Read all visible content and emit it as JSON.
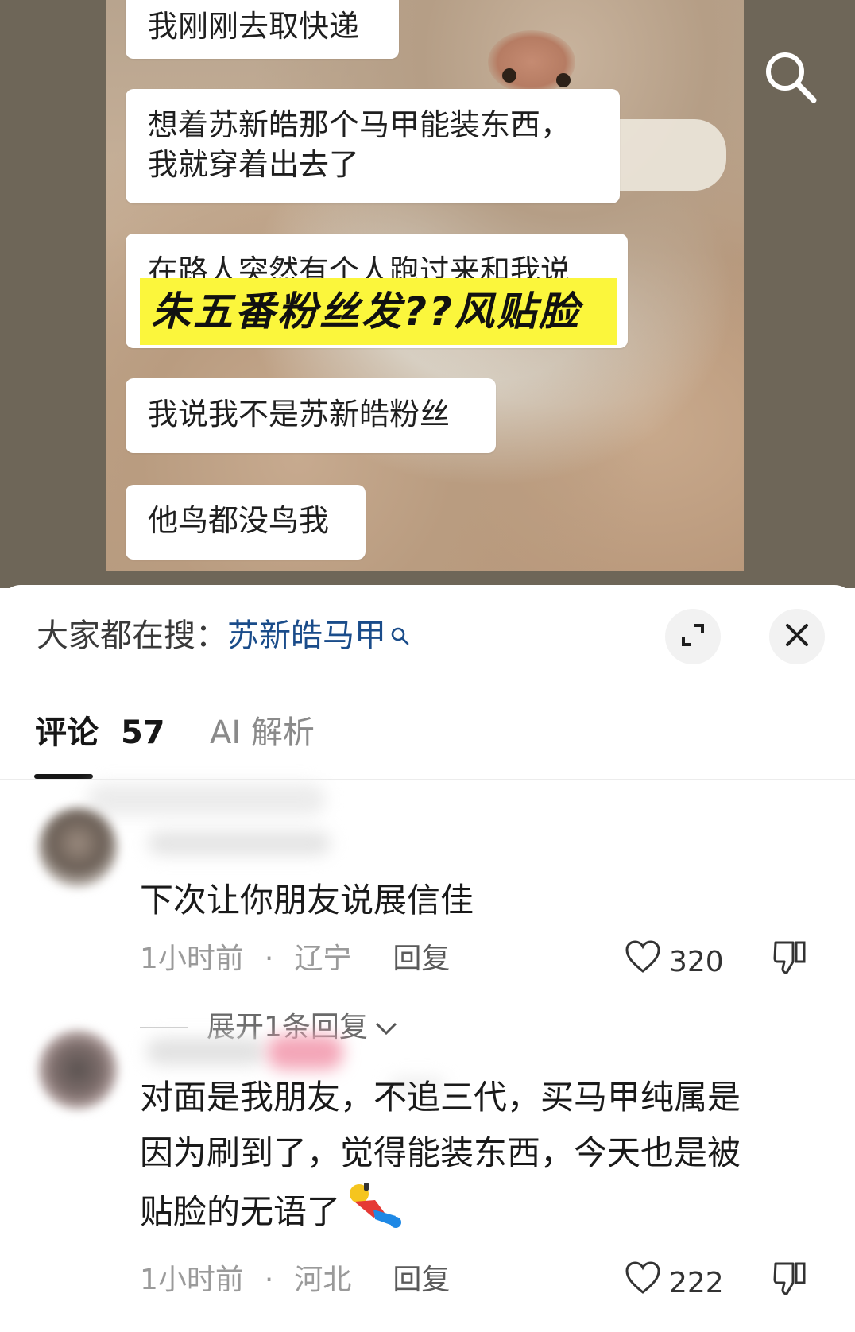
{
  "video": {
    "bubbles": [
      "我刚刚去取快递",
      "想着苏新皓那个马甲能装东西，",
      "我就穿着出去了",
      "在路人突然有个人跑过来和我说",
      "我说我不是苏新皓粉丝",
      "他鸟都没鸟我"
    ],
    "overlay_banner": "朱五番粉丝发??风贴脸",
    "icon": "search-icon"
  },
  "sheet": {
    "trending_label": "大家都在搜：",
    "trending_term": "苏新皓马甲",
    "tabs": {
      "comments_label": "评论",
      "comments_count": "57",
      "ai_label": "AI 解析"
    },
    "comments": [
      {
        "text": "下次让你朋友说展信佳",
        "time": "1小时前",
        "region": "辽宁",
        "reply_label": "回复",
        "likes": "320",
        "expand_replies": "展开1条回复"
      },
      {
        "text_lines": [
          "对面是我朋友，不追三代，买马甲纯属是",
          "因为刷到了，觉得能装东西，今天也是被",
          "贴脸的无语了"
        ],
        "time": "1小时前",
        "region": "河北",
        "reply_label": "回复",
        "likes": "222"
      }
    ]
  },
  "colors": {
    "trending_link": "#1a4c8a",
    "banner_yellow": "#fbf63c",
    "sheet_bg": "#ffffff"
  }
}
